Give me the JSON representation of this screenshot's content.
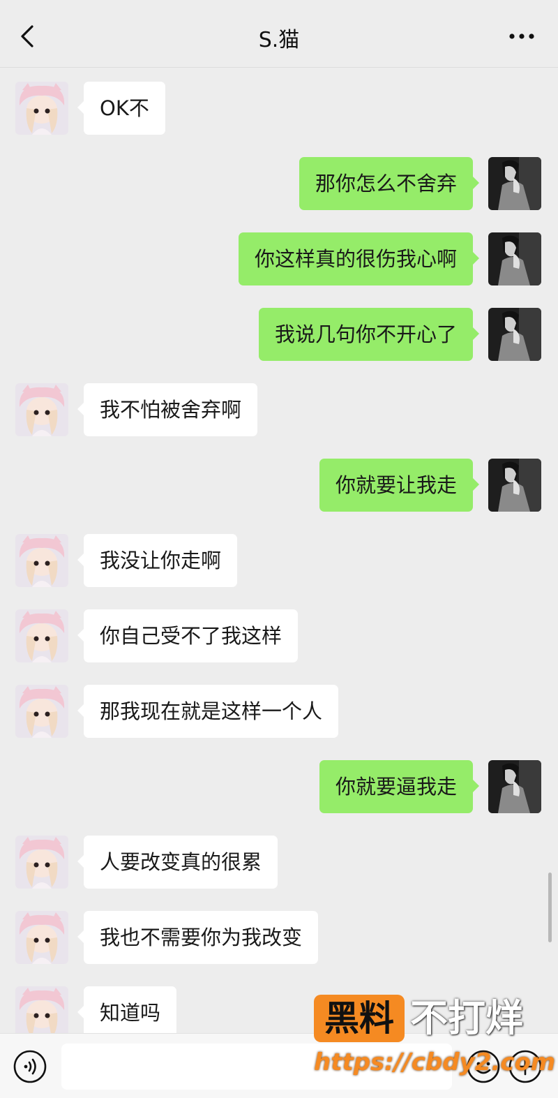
{
  "header": {
    "title": "S.猫"
  },
  "messages": [
    {
      "side": "in",
      "text": "OK不"
    },
    {
      "side": "out",
      "text": "那你怎么不舍弃"
    },
    {
      "side": "out",
      "text": "你这样真的很伤我心啊"
    },
    {
      "side": "out",
      "text": "我说几句你不开心了"
    },
    {
      "side": "in",
      "text": "我不怕被舍弃啊"
    },
    {
      "side": "out",
      "text": "你就要让我走"
    },
    {
      "side": "in",
      "text": "我没让你走啊"
    },
    {
      "side": "in",
      "text": "你自己受不了我这样"
    },
    {
      "side": "in",
      "text": "那我现在就是这样一个人"
    },
    {
      "side": "out",
      "text": "你就要逼我走"
    },
    {
      "side": "in",
      "text": "人要改变真的很累"
    },
    {
      "side": "in",
      "text": "我也不需要你为我改变"
    },
    {
      "side": "in",
      "text": "知道吗"
    }
  ],
  "watermark": {
    "brand": "黑料",
    "slogan": "不打烊",
    "url": "https://cbdy2.com"
  },
  "colors": {
    "background": "#ededed",
    "sent_bubble": "#95ec69",
    "received_bubble": "#ffffff",
    "watermark_accent": "#f58a22"
  },
  "icons": {
    "back": "chevron-left-icon",
    "more": "more-dots-icon",
    "voice": "voice-icon",
    "emoji": "emoji-icon",
    "plus": "plus-icon"
  }
}
